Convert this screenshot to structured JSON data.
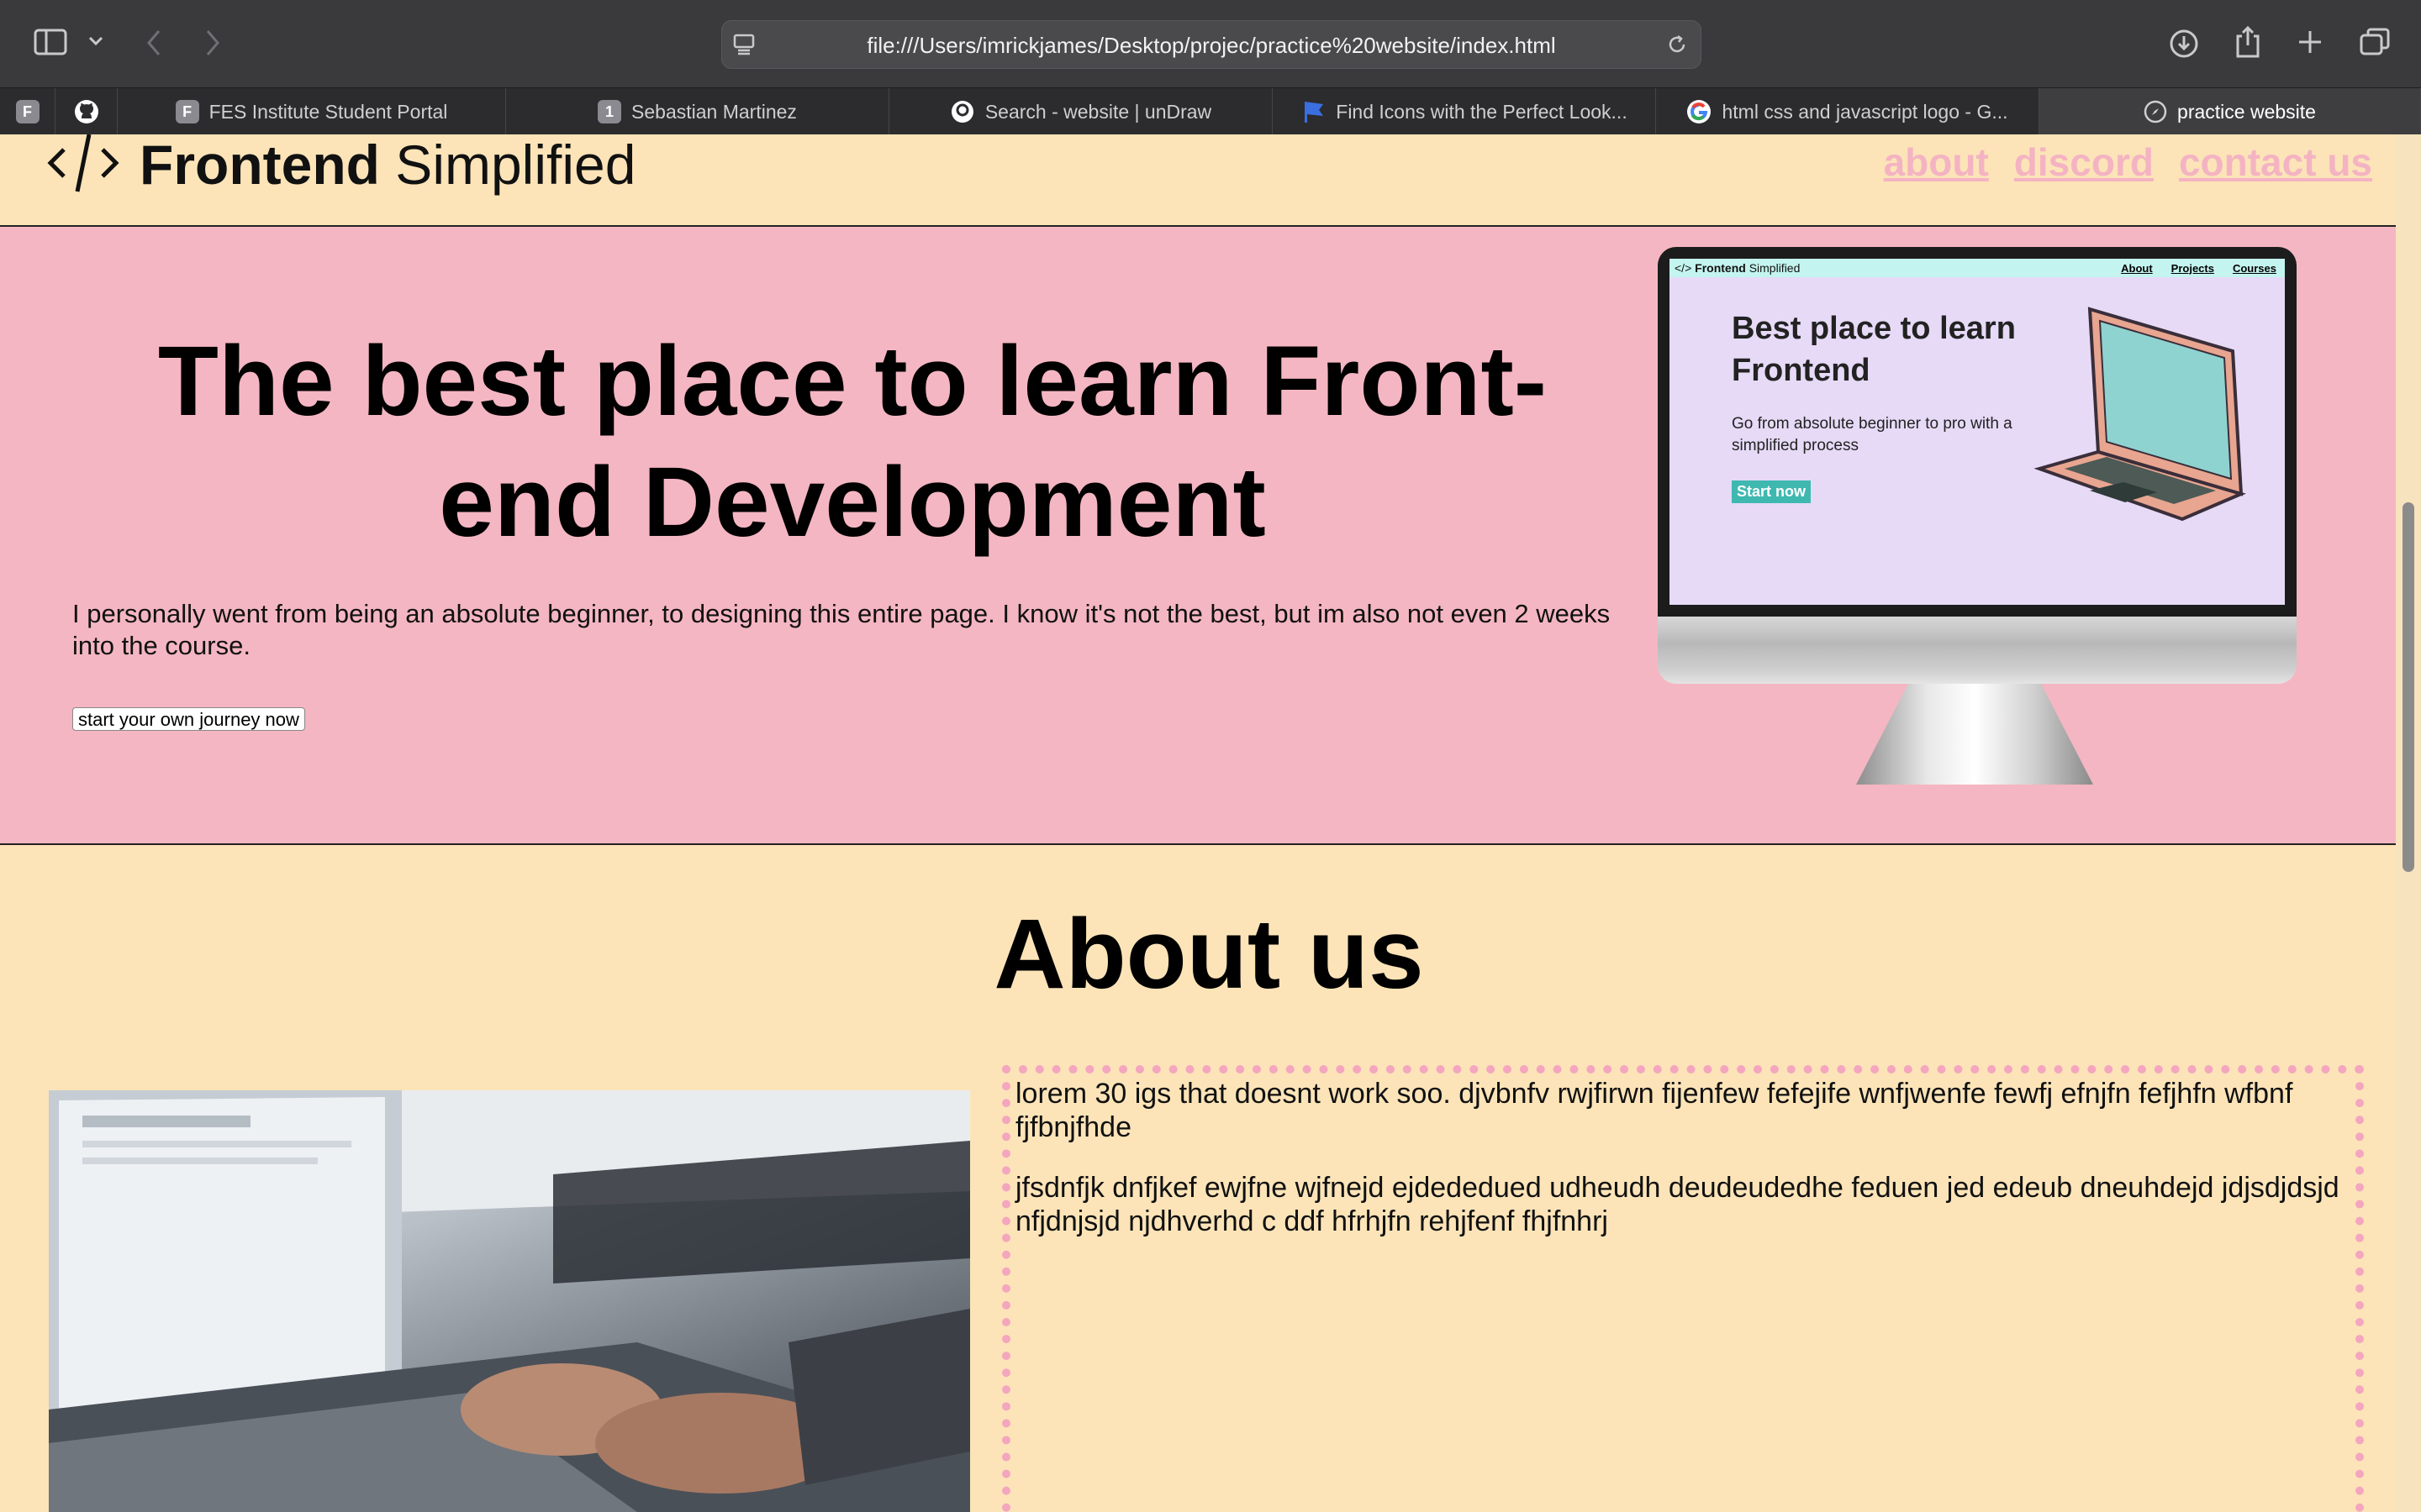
{
  "browser": {
    "url": "file:///Users/imrickjames/Desktop/projec/practice%20website/index.html",
    "tabs": [
      {
        "label": "FES Institute Student Portal",
        "icon": "F"
      },
      {
        "label": "Sebastian Martinez",
        "icon": "1"
      },
      {
        "label": "Search - website | unDraw",
        "icon": "undraw-icon"
      },
      {
        "label": "Find Icons with the Perfect Look...",
        "icon": "flag-icon"
      },
      {
        "label": "html css and javascript logo - G...",
        "icon": "google-icon"
      },
      {
        "label": "practice website",
        "icon": "compass-icon"
      }
    ],
    "pinned": [
      {
        "icon": "F"
      },
      {
        "icon": "github-icon"
      }
    ]
  },
  "site": {
    "logo_bold": "Frontend",
    "logo_light": "Simplified",
    "nav": [
      "about",
      "discord",
      "contact us"
    ],
    "hero": {
      "heading": "The best place to learn Front-end Development",
      "text": "I personally went from being an absolute beginner, to designing this entire page. I know it's not the best, but im also not even 2 weeks into the course.",
      "button": "start your own journey now"
    },
    "monitor": {
      "logo_bold": "Frontend",
      "logo_light": "Simplified",
      "nav": [
        "About",
        "Projects",
        "Courses"
      ],
      "heading": "Best place to learn Frontend",
      "subtext": "Go from absolute beginner to pro with a simplified process",
      "button": "Start now"
    },
    "about": {
      "title": "About us",
      "paragraphs": [
        "lorem 30 igs that doesnt work soo. djvbnfv rwjfirwn fijenfew fefejife wnfjwenfe fewfj efnjfn fefjhfn wfbnf fjfbnjfhde",
        "jfsdnfjk dnfjkef ewjfne wjfnejd ejdededued udheudh deudeudedhe feduen jed edeub dneuhdejd jdjsdjdsjd nfjdnjsjd njdhverhd c ddf hfrhjfn rehjfenf fhjfnhrj"
      ]
    }
  },
  "colors": {
    "nav_bg": "#fce4b8",
    "hero_bg": "#f4b6c2",
    "link": "#f4b3c2",
    "monitor_screen": "#e6daf7"
  }
}
